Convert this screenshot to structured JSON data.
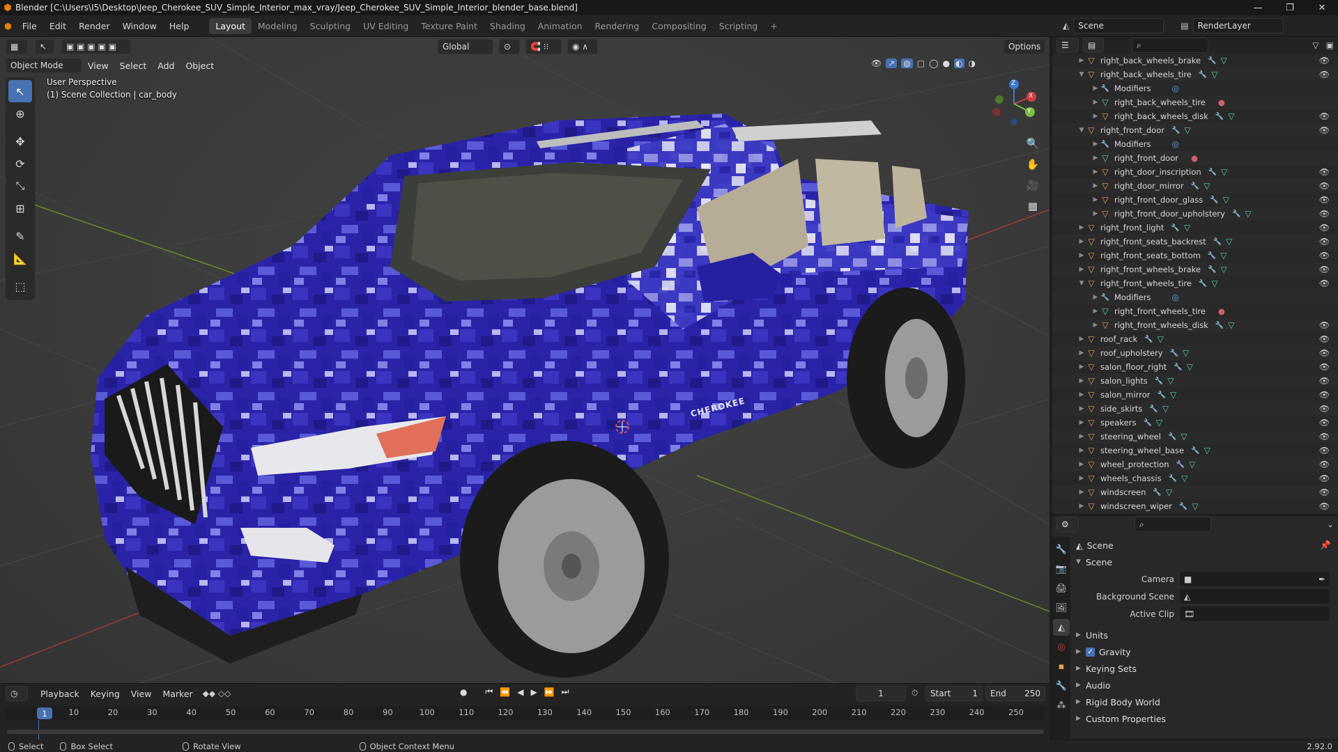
{
  "titlebar": {
    "title": "Blender [C:\\Users\\I5\\Desktop\\Jeep_Cherokee_SUV_Simple_Interior_max_vray/Jeep_Cherokee_SUV_Simple_Interior_blender_base.blend]",
    "minimize": "—",
    "maximize": "❐",
    "close": "✕"
  },
  "menus": [
    "File",
    "Edit",
    "Render",
    "Window",
    "Help"
  ],
  "workspaces": [
    "Layout",
    "Modeling",
    "Sculpting",
    "UV Editing",
    "Texture Paint",
    "Shading",
    "Animation",
    "Rendering",
    "Compositing",
    "Scripting"
  ],
  "add_workspace": "+",
  "scene_name": "Scene",
  "render_layer": "RenderLayer",
  "viewport": {
    "mode": "Object Mode",
    "menus": [
      "View",
      "Select",
      "Add",
      "Object"
    ],
    "transform_orientation": "Global",
    "options_label": "Options",
    "info_line1": "User Perspective",
    "info_line2": "(1) Scene Collection | car_body",
    "brand_text": "CHEROKEE",
    "gizmo": {
      "x": "X",
      "y": "Y",
      "z": "Z"
    }
  },
  "outliner": {
    "items": [
      {
        "name": "right_back_wheels_brake",
        "type": "object",
        "depth": 0,
        "expanded": false,
        "eye": true
      },
      {
        "name": "right_back_wheels_tire",
        "type": "object",
        "depth": 0,
        "expanded": true,
        "eye": true
      },
      {
        "name": "Modifiers",
        "type": "modifier",
        "depth": 1,
        "expanded": false,
        "eye": false
      },
      {
        "name": "right_back_wheels_tire",
        "type": "mesh",
        "depth": 1,
        "expanded": false,
        "eye": false
      },
      {
        "name": "right_back_wheels_disk",
        "type": "object",
        "depth": 1,
        "expanded": false,
        "eye": true
      },
      {
        "name": "right_front_door",
        "type": "object",
        "depth": 0,
        "expanded": true,
        "eye": true
      },
      {
        "name": "Modifiers",
        "type": "modifier",
        "depth": 1,
        "expanded": false,
        "eye": false
      },
      {
        "name": "right_front_door",
        "type": "mesh",
        "depth": 1,
        "expanded": false,
        "eye": false
      },
      {
        "name": "right_door_inscription",
        "type": "object",
        "depth": 1,
        "expanded": false,
        "eye": true
      },
      {
        "name": "right_door_mirror",
        "type": "object",
        "depth": 1,
        "expanded": false,
        "eye": true
      },
      {
        "name": "right_front_door_glass",
        "type": "object",
        "depth": 1,
        "expanded": false,
        "eye": true
      },
      {
        "name": "right_front_door_upholstery",
        "type": "object",
        "depth": 1,
        "expanded": false,
        "eye": true
      },
      {
        "name": "right_front_light",
        "type": "object",
        "depth": 0,
        "expanded": false,
        "eye": true
      },
      {
        "name": "right_front_seats_backrest",
        "type": "object",
        "depth": 0,
        "expanded": false,
        "eye": true
      },
      {
        "name": "right_front_seats_bottom",
        "type": "object",
        "depth": 0,
        "expanded": false,
        "eye": true
      },
      {
        "name": "right_front_wheels_brake",
        "type": "object",
        "depth": 0,
        "expanded": false,
        "eye": true
      },
      {
        "name": "right_front_wheels_tire",
        "type": "object",
        "depth": 0,
        "expanded": true,
        "eye": true
      },
      {
        "name": "Modifiers",
        "type": "modifier",
        "depth": 1,
        "expanded": false,
        "eye": false
      },
      {
        "name": "right_front_wheels_tire",
        "type": "mesh",
        "depth": 1,
        "expanded": false,
        "eye": false
      },
      {
        "name": "right_front_wheels_disk",
        "type": "object",
        "depth": 1,
        "expanded": false,
        "eye": true
      },
      {
        "name": "roof_rack",
        "type": "object",
        "depth": 0,
        "expanded": false,
        "eye": true
      },
      {
        "name": "roof_upholstery",
        "type": "object",
        "depth": 0,
        "expanded": false,
        "eye": true
      },
      {
        "name": "salon_floor_right",
        "type": "object",
        "depth": 0,
        "expanded": false,
        "eye": true
      },
      {
        "name": "salon_lights",
        "type": "object",
        "depth": 0,
        "expanded": false,
        "eye": true
      },
      {
        "name": "salon_mirror",
        "type": "object",
        "depth": 0,
        "expanded": false,
        "eye": true
      },
      {
        "name": "side_skirts",
        "type": "object",
        "depth": 0,
        "expanded": false,
        "eye": true
      },
      {
        "name": "speakers",
        "type": "object",
        "depth": 0,
        "expanded": false,
        "eye": true
      },
      {
        "name": "steering_wheel",
        "type": "object",
        "depth": 0,
        "expanded": false,
        "eye": true
      },
      {
        "name": "steering_wheel_base",
        "type": "object",
        "depth": 0,
        "expanded": false,
        "eye": true
      },
      {
        "name": "wheel_protection",
        "type": "object",
        "depth": 0,
        "expanded": false,
        "eye": true
      },
      {
        "name": "wheels_chassis",
        "type": "object",
        "depth": 0,
        "expanded": false,
        "eye": true
      },
      {
        "name": "windscreen",
        "type": "object",
        "depth": 0,
        "expanded": false,
        "eye": true
      },
      {
        "name": "windscreen_wiper",
        "type": "object",
        "depth": 0,
        "expanded": false,
        "eye": true
      }
    ]
  },
  "properties": {
    "context_title": "Scene",
    "panel_title": "Scene",
    "camera_label": "Camera",
    "background_scene_label": "Background Scene",
    "active_clip_label": "Active Clip",
    "sections": [
      "Units",
      "Gravity",
      "Keying Sets",
      "Audio",
      "Rigid Body World",
      "Custom Properties"
    ],
    "gravity_checked": true
  },
  "timeline": {
    "menus": [
      "Playback",
      "Keying",
      "View",
      "Marker"
    ],
    "current_frame": "1",
    "start_label": "Start",
    "start": "1",
    "end_label": "End",
    "end": "250",
    "ticks": [
      "1",
      "10",
      "20",
      "30",
      "40",
      "50",
      "60",
      "70",
      "80",
      "90",
      "100",
      "110",
      "120",
      "130",
      "140",
      "150",
      "160",
      "170",
      "180",
      "190",
      "200",
      "210",
      "220",
      "230",
      "240",
      "250"
    ]
  },
  "statusbar": {
    "select": "Select",
    "box_select": "Box Select",
    "rotate_view": "Rotate View",
    "context_menu": "Object Context Menu",
    "version": "2.92.0"
  }
}
